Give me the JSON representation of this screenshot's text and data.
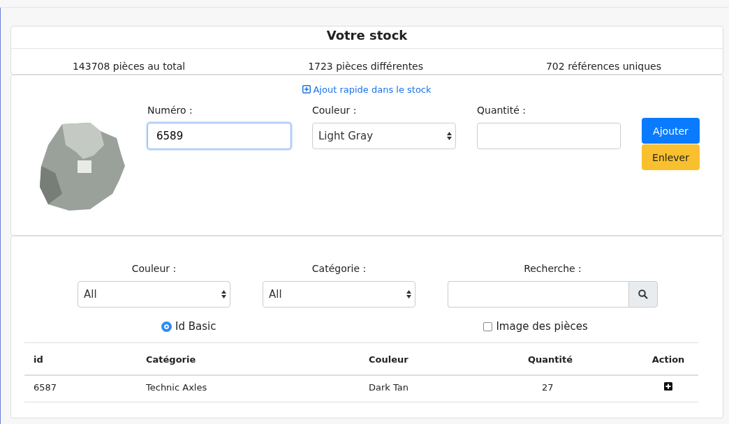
{
  "stock": {
    "title": "Votre stock",
    "stats": [
      "143708 pièces au total",
      "1723 pièces différentes",
      "702 références uniques"
    ]
  },
  "quick_add": {
    "link": "Ajout rapide dans le stock",
    "numero": {
      "label": "Numéro :",
      "value": "6589",
      "focused": true
    },
    "couleur": {
      "label": "Couleur :",
      "value": "Light Gray"
    },
    "quantite": {
      "label": "Quantité :"
    },
    "buttons": [
      {
        "label": "Ajouter",
        "kind": "primary"
      },
      {
        "label": "Enlever",
        "kind": "warning"
      }
    ]
  },
  "filters": {
    "couleur": {
      "label": "Couleur :",
      "value": "All"
    },
    "categorie": {
      "label": "Catégorie :",
      "value": "All"
    },
    "recherche": {
      "label": "Recherche :"
    },
    "options": [
      {
        "label": "Id Basic",
        "kind": "radio",
        "checked": true
      },
      {
        "label": "Image des pièces",
        "kind": "checkbox",
        "checked": false
      }
    ]
  },
  "table": {
    "columns": [
      "id",
      "Catégorie",
      "Couleur",
      "Quantité",
      "Action"
    ],
    "rows": [
      {
        "id": "6587",
        "categorie": "Technic Axles",
        "couleur": "Dark Tan",
        "quantite": "27"
      }
    ]
  }
}
